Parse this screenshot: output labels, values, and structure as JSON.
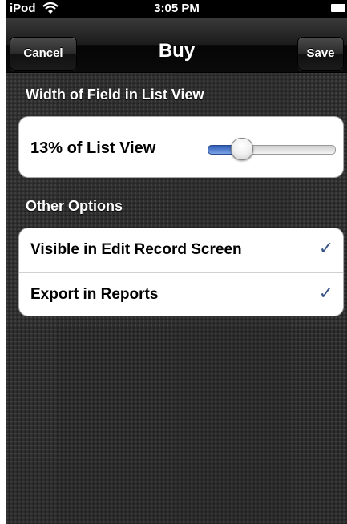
{
  "status_bar": {
    "carrier": "iPod",
    "time": "3:05 PM",
    "wifi_icon": "wifi-icon",
    "battery_icon": "battery-icon"
  },
  "nav_bar": {
    "title": "Buy",
    "cancel_label": "Cancel",
    "save_label": "Save"
  },
  "width_section": {
    "header": "Width of Field in List View",
    "slider_label": "13% of List View",
    "slider_value": 0.13
  },
  "options_section": {
    "header": "Other Options",
    "items": [
      {
        "label": "Visible in Edit Record Screen",
        "checked": true,
        "icon": "checkmark-icon"
      },
      {
        "label": "Export in Reports",
        "checked": true,
        "icon": "checkmark-icon"
      }
    ]
  },
  "colors": {
    "checkmark": "#385487",
    "slider_fill": "#2f5bb5"
  }
}
